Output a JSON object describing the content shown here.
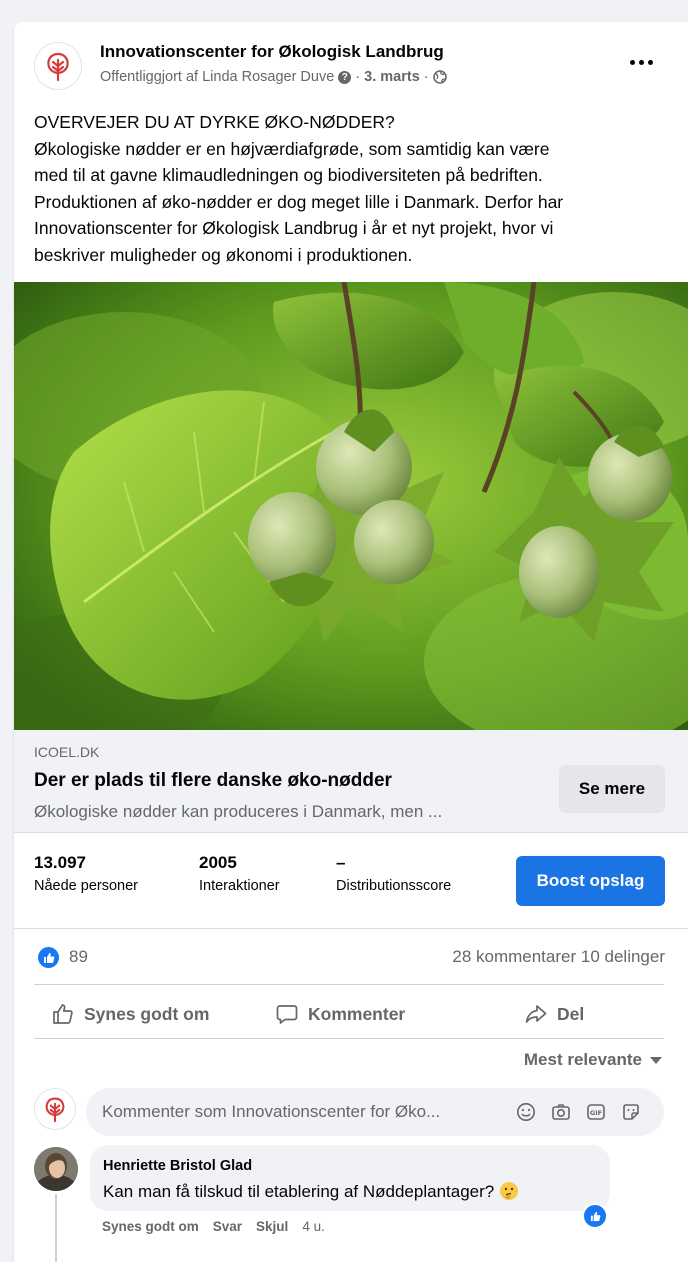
{
  "post": {
    "page_name": "Innovationscenter for Økologisk Landbrug",
    "published_by": "Offentliggjort af Linda Rosager Duve",
    "date": "3. marts",
    "separator": "·",
    "text_lines": [
      "OVERVEJER DU AT DYRKE ØKO-NØDDER?",
      "Økologiske nødder er en højværdiafgrøde, som samtidig kan være",
      "med til at gavne klimaudledningen og biodiversiteten på bedriften.",
      "Produktionen af øko-nødder er dog meget lille i Danmark. Derfor har",
      "Innovationscenter for Økologisk Landbrug i år et nyt projekt, hvor vi",
      "beskriver muligheder og økonomi i produktionen."
    ]
  },
  "link_preview": {
    "domain": "ICOEL.DK",
    "title": "Der er plads til flere danske øko-nødder",
    "description": "Økologiske nødder kan produceres i Danmark, men ...",
    "button": "Se mere"
  },
  "stats": {
    "reached_value": "13.097",
    "reached_label": "Nåede personer",
    "interactions_value": "2005",
    "interactions_label": "Interaktioner",
    "distribution_value": "–",
    "distribution_label": "Distributionsscore",
    "boost_button": "Boost opslag"
  },
  "engagement": {
    "likes": "89",
    "comments": "28 kommentarer",
    "shares": "10 delinger"
  },
  "actions": {
    "like": "Synes godt om",
    "comment": "Kommenter",
    "share": "Del"
  },
  "comments": {
    "sort_label": "Mest relevante",
    "composer_placeholder": "Kommenter som Innovationscenter for Øko...",
    "items": [
      {
        "author": "Henriette Bristol Glad",
        "text": "Kan man få tilskud til etablering af Nøddeplantager?",
        "like_action": "Synes godt om",
        "reply_action": "Svar",
        "hide_action": "Skjul",
        "age": "4 u."
      }
    ]
  },
  "colors": {
    "brand_blue": "#1b74e4",
    "logo_red": "#d63a3a",
    "secondary_text": "#65676b"
  }
}
